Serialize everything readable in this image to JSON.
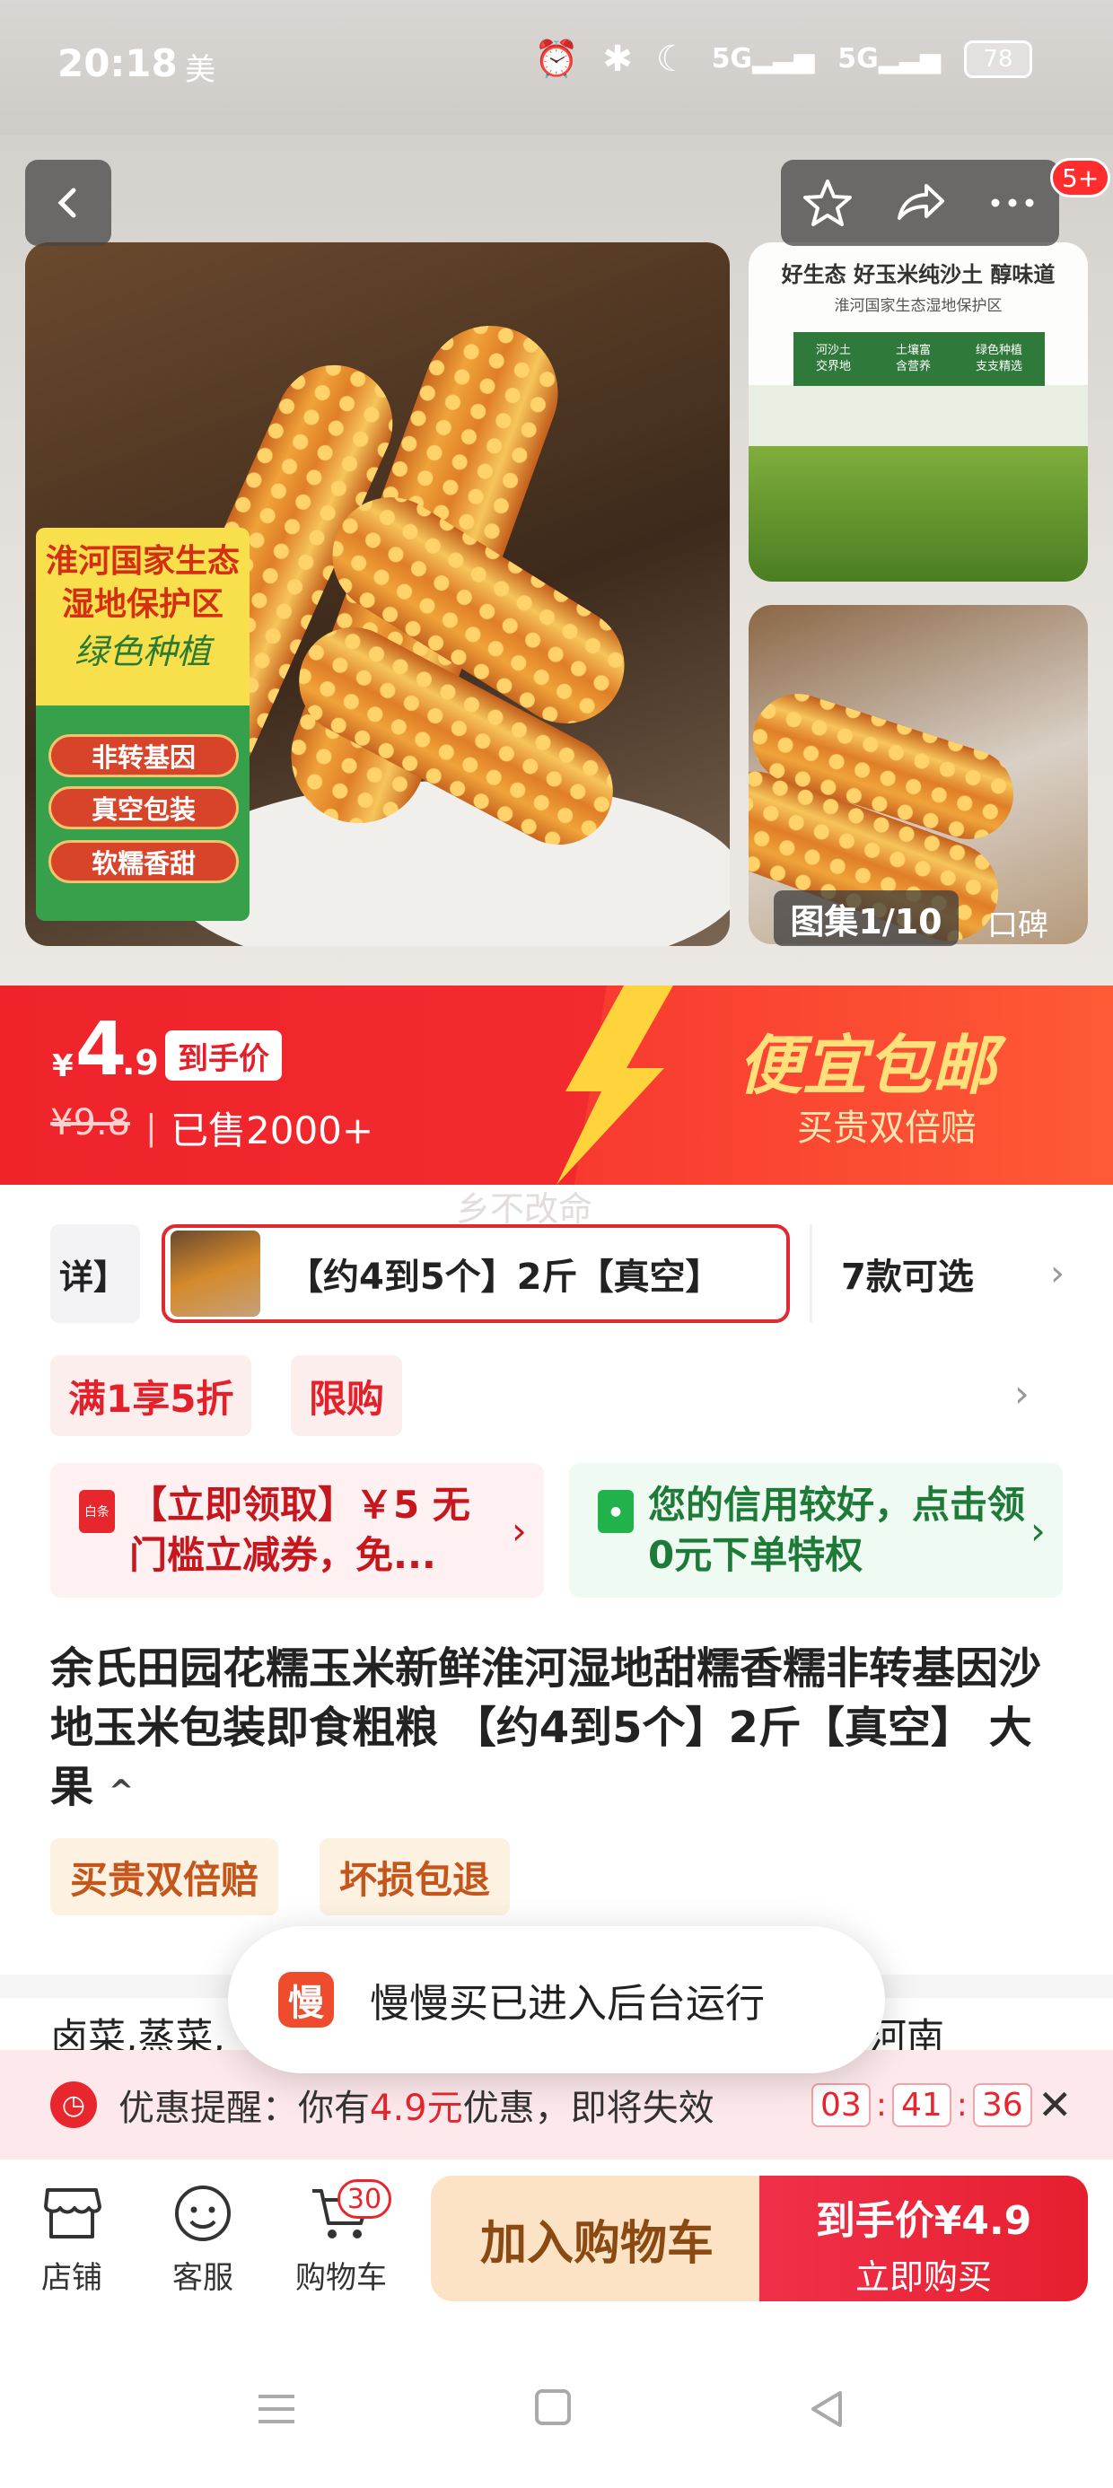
{
  "status_bar": {
    "time": "20:18",
    "extra": "美",
    "signal1": "5G",
    "signal2": "5G",
    "battery": "78"
  },
  "gallery": {
    "more_badge": "5+",
    "counter": "图集1/10",
    "extra_label": "口碑",
    "main_image_tag": {
      "line1": "淮河国家生态",
      "line2": "湿地保护区",
      "line3": "绿色种植",
      "tags": [
        "非转基因",
        "真空包装",
        "软糯香甜"
      ]
    },
    "side_image_1": {
      "title": "好生态 好玉米纯沙土 醇味道",
      "subtitle": "淮河国家生态湿地保护区",
      "chips": [
        "河沙土\n交界地",
        "土壤富\n含营养",
        "绿色种植\n支支精选"
      ]
    }
  },
  "price_banner": {
    "currency": "¥",
    "price_int": "4",
    "price_dec": ".9",
    "price_tag": "到手价",
    "original_price": "¥9.8",
    "divider": "|",
    "sold": "已售2000+",
    "slogan": "便宜包邮",
    "slogan_sub": "买贵双倍赔"
  },
  "watermark": "乡不改命",
  "spec": {
    "left_partial": "详】",
    "selected": "【约4到5个】2斤【真空】",
    "more": "7款可选"
  },
  "promo_tags": [
    "满1享5折",
    "限购"
  ],
  "coupons": {
    "red": "【立即领取】￥5 无门槛立减券，免...",
    "green": "您的信用较好，点击领0元下单特权",
    "red_icon_label": "白条"
  },
  "product": {
    "title": "余氏田园花糯玉米新鲜淮河湿地甜糯香糯非转基因沙地玉米包装即食粗粮 【约4到5个】2斤【真空】 大果",
    "collapse_glyph": "^",
    "services": [
      "买贵双倍赔",
      "坏损包退"
    ],
    "desc_peek": "卤菜,蒸菜,"
  },
  "desc_peek_right": "河南",
  "toast": {
    "logo": "慢",
    "text": "慢慢买已进入后台运行"
  },
  "reminder": {
    "label": "优惠提醒：你有",
    "amount": "4.9元",
    "suffix": "优惠，即将失效",
    "hours": "03",
    "minutes": "41",
    "seconds": "36",
    "sep": ":"
  },
  "bottom_bar": {
    "shop": "店铺",
    "service": "客服",
    "cart": "购物车",
    "cart_count": "30",
    "add_to_cart": "加入购物车",
    "buy_price_label": "到手价",
    "buy_price": "¥4.9",
    "buy_now": "立即购买"
  },
  "colors": {
    "brand_red": "#e8262e",
    "banner_yellow": "#ffe07a",
    "green_card": "#1d7a37"
  }
}
